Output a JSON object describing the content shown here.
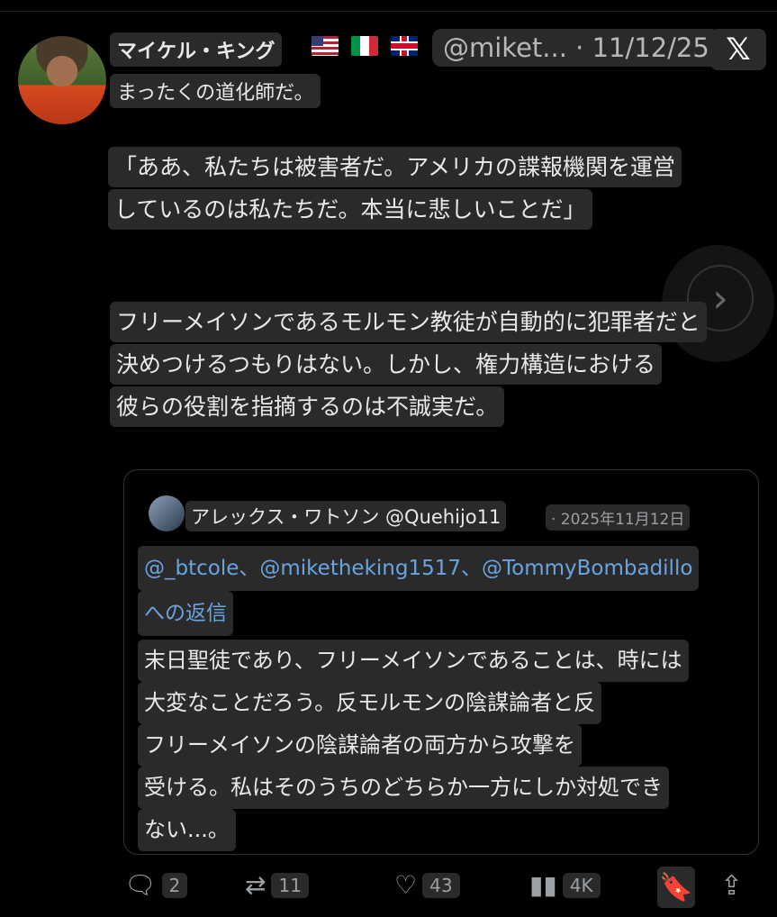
{
  "post": {
    "author_name": "マイケル・キング",
    "handle_date": "@miket... · 11/12/25",
    "x_logo": "𝕏",
    "line1": "まったくの道化師だ。",
    "p1": [
      "「ああ、私たちは被害者だ。アメリカの諜報機関を運営",
      "しているのは私たちだ。本当に悲しいことだ」"
    ],
    "p2": [
      "フリーメイソンであるモルモン教徒が自動的に犯罪者だと",
      "決めつけるつもりはない。しかし、権力構造における",
      "彼らの役割を指摘するのは不誠実だ。"
    ]
  },
  "quote": {
    "name_handle": "アレックス・ワトソン @Quehijo11",
    "date": "· 2025年11月12日",
    "reply_line1": "@_btcole、@miketheking1517、@TommyBombadillo",
    "reply_line2": "への返信",
    "text": [
      "末日聖徒であり、フリーメイソンであることは、時には",
      "大変なことだろう。反モルモンの陰謀論者と反",
      "フリーメイソンの陰謀論者の両方から攻撃を",
      "受ける。私はそのうちのどちらか一方にしか対処でき",
      "ない...。"
    ]
  },
  "actions": {
    "replies": "2",
    "reposts": "11",
    "likes": "43",
    "views": "4K"
  },
  "icons": {
    "reply": "reply-icon",
    "repost": "repost-icon",
    "like": "heart-icon",
    "views": "views-icon",
    "bookmark": "bookmark-icon",
    "share": "share-icon",
    "next": "chevron-right-icon"
  }
}
